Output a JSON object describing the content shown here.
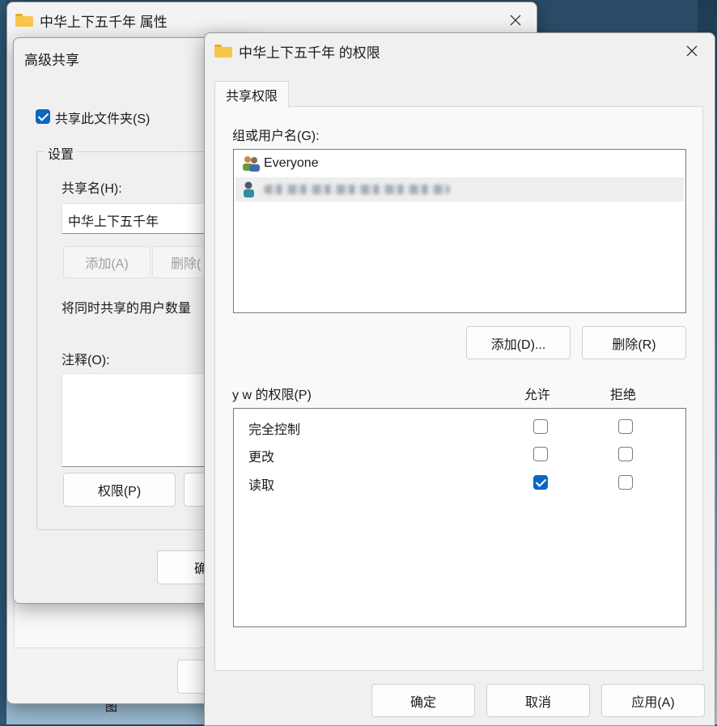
{
  "desktop": {
    "bottom_glyph": "图"
  },
  "props_window": {
    "title": "中华上下五千年 属性",
    "close_icon": "close-icon"
  },
  "advanced_sharing": {
    "title": "高级共享",
    "share_checkbox_label": "共享此文件夹(S)",
    "share_checked": true,
    "settings_legend": "设置",
    "share_name_label": "共享名(H):",
    "share_name_value": "中华上下五千年",
    "add_button": "添加(A)",
    "remove_button": "删除(",
    "limit_label": "将同时共享的用户数量",
    "comment_label": "注释(O):",
    "permissions_button": "权限(P)",
    "ok_button_partial": "确"
  },
  "permissions_window": {
    "title": "中华上下五千年 的权限",
    "tab": "共享权限",
    "group_label": "组或用户名(G):",
    "users": [
      {
        "name": "Everyone",
        "icon": "group-users-icon",
        "selected": false
      },
      {
        "name": "",
        "icon": "user-icon",
        "selected": true,
        "blurred": true
      }
    ],
    "add_button": "添加(D)...",
    "remove_button": "删除(R)",
    "perm_header": "y w 的权限(P)",
    "allow_header": "允许",
    "deny_header": "拒绝",
    "permissions": [
      {
        "name": "完全控制",
        "allow": false,
        "deny": false
      },
      {
        "name": "更改",
        "allow": false,
        "deny": false
      },
      {
        "name": "读取",
        "allow": true,
        "deny": false
      }
    ],
    "ok_button": "确定",
    "cancel_button": "取消",
    "apply_button": "应用(A)"
  }
}
